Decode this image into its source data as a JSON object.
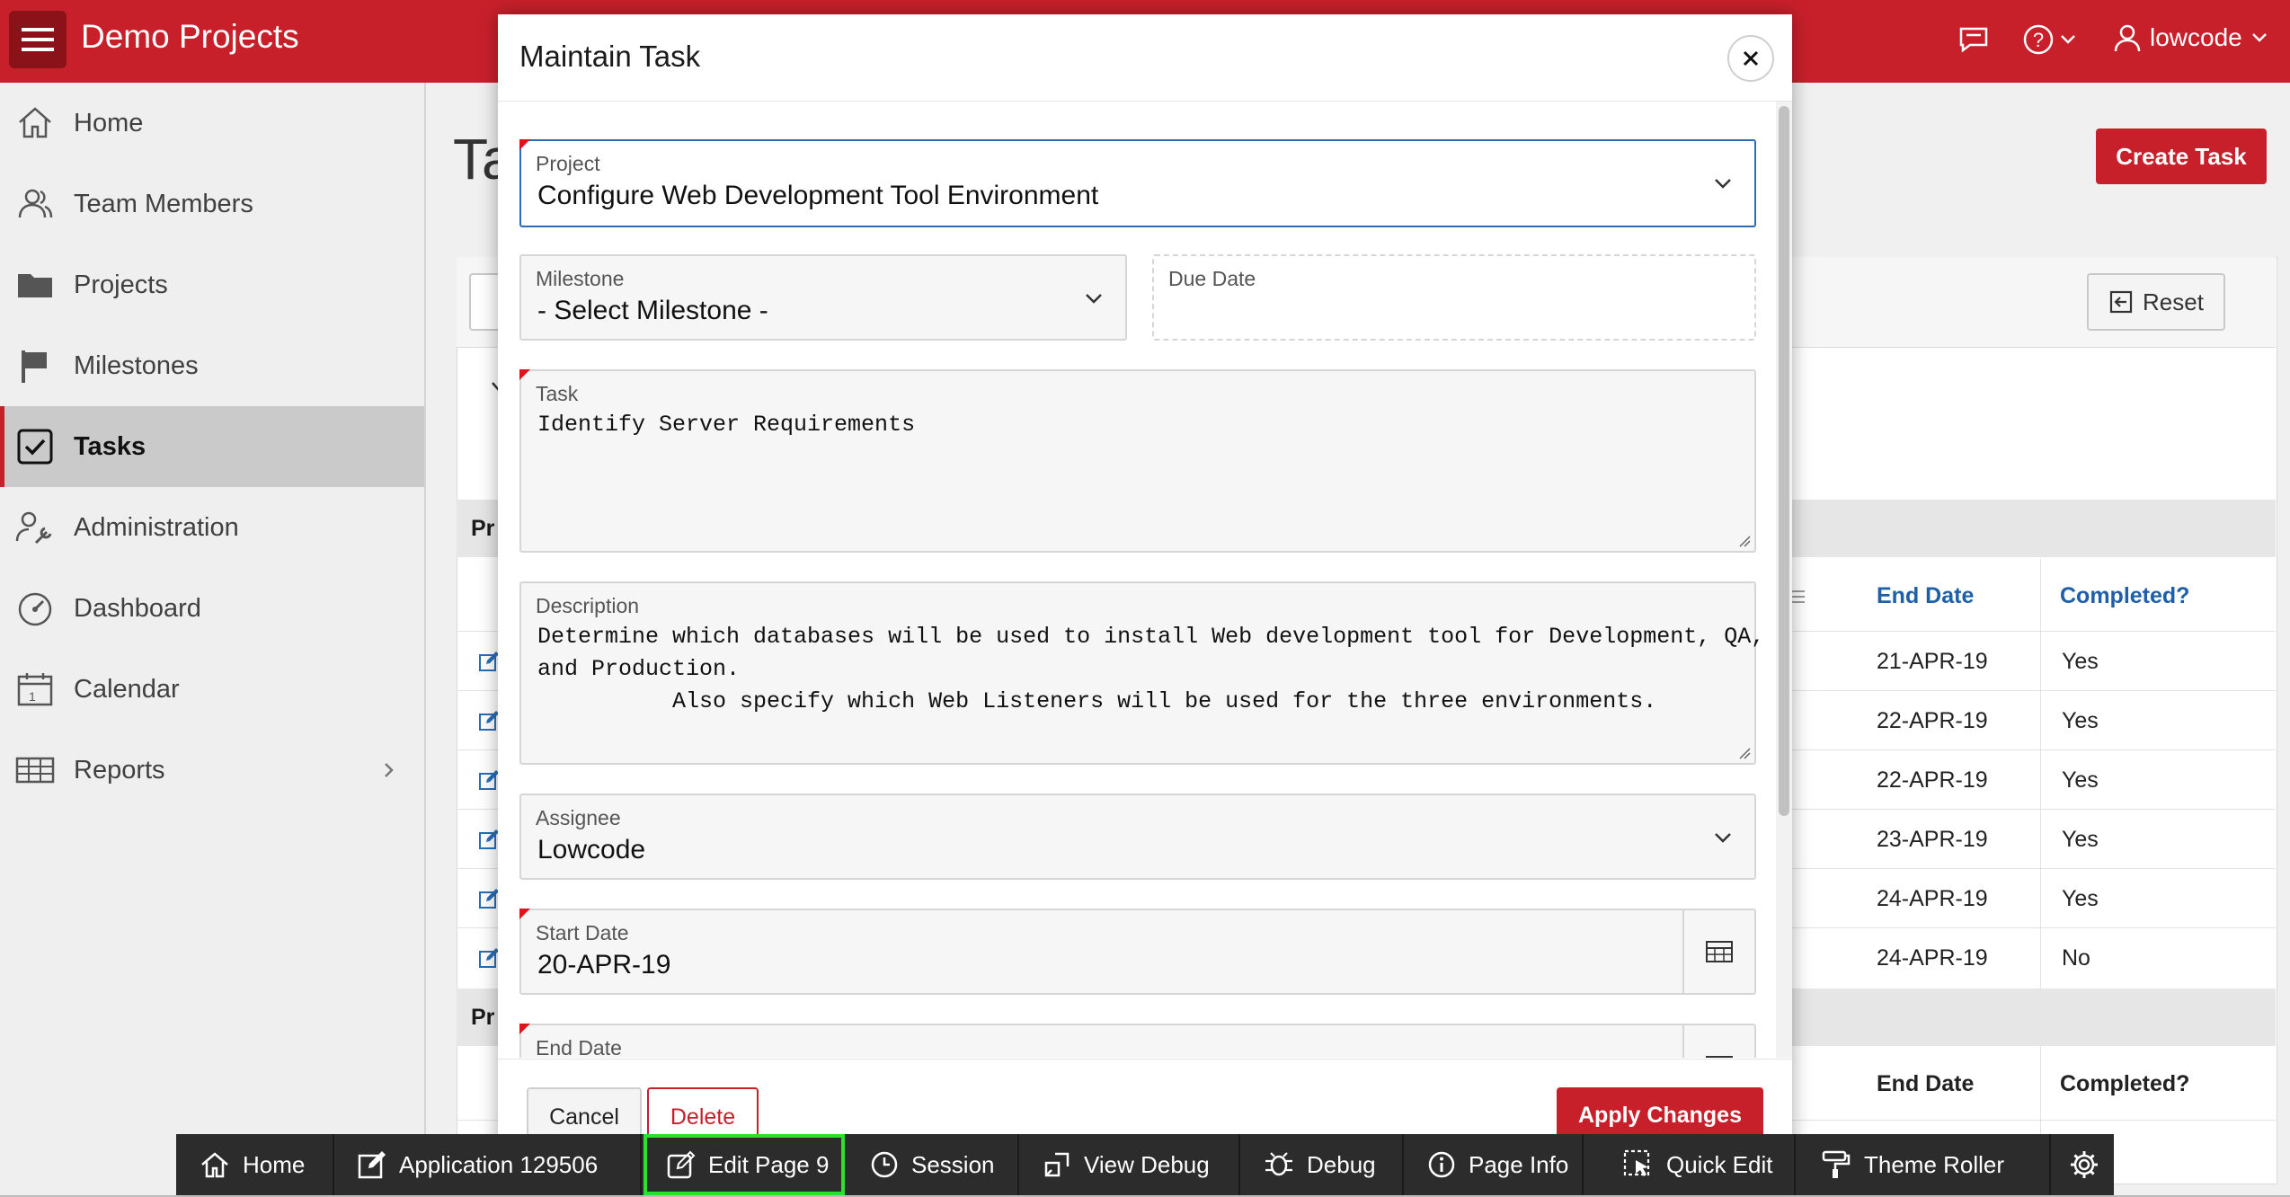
{
  "header": {
    "app_title": "Demo Projects",
    "user": "lowcode",
    "icons": [
      "hamburger-menu-icon",
      "chat-icon",
      "help-icon",
      "user-icon"
    ]
  },
  "sidebar": {
    "items": [
      {
        "label": "Home",
        "icon": "home-icon"
      },
      {
        "label": "Team Members",
        "icon": "people-icon"
      },
      {
        "label": "Projects",
        "icon": "folder-icon"
      },
      {
        "label": "Milestones",
        "icon": "flag-icon"
      },
      {
        "label": "Tasks",
        "icon": "checkbox-icon",
        "active": true
      },
      {
        "label": "Administration",
        "icon": "wrench-user-icon"
      },
      {
        "label": "Dashboard",
        "icon": "gauge-icon"
      },
      {
        "label": "Calendar",
        "icon": "calendar-icon"
      },
      {
        "label": "Reports",
        "icon": "table-icon"
      }
    ]
  },
  "background_page": {
    "title_partial": "Ta",
    "create_button": "Create Task",
    "reset_button": "Reset",
    "group_label_partial": "Pr",
    "group2_label_partial": "Pr",
    "columns": {
      "end_date": "End Date",
      "completed": "Completed?"
    },
    "rows": [
      {
        "end_date": "21-APR-19",
        "completed": "Yes"
      },
      {
        "end_date": "22-APR-19",
        "completed": "Yes"
      },
      {
        "end_date": "22-APR-19",
        "completed": "Yes"
      },
      {
        "end_date": "23-APR-19",
        "completed": "Yes"
      },
      {
        "end_date": "24-APR-19",
        "completed": "Yes"
      },
      {
        "end_date": "24-APR-19",
        "completed": "No"
      }
    ],
    "columns2": {
      "end_date": "End Date",
      "completed": "Completed?"
    }
  },
  "modal": {
    "title": "Maintain Task",
    "fields": {
      "project": {
        "label": "Project",
        "value": "Configure Web Development Tool Environment"
      },
      "milestone": {
        "label": "Milestone",
        "value": "- Select Milestone -"
      },
      "due_date": {
        "label": "Due Date",
        "value": ""
      },
      "task": {
        "label": "Task",
        "value": "Identify Server Requirements"
      },
      "description": {
        "label": "Description",
        "value": "Determine which databases will be used to install Web development tool for Development, QA,\nand Production.\n          Also specify which Web Listeners will be used for the three environments."
      },
      "assignee": {
        "label": "Assignee",
        "value": "Lowcode"
      },
      "start_date": {
        "label": "Start Date",
        "value": "20-APR-19"
      },
      "end_date": {
        "label": "End Date",
        "value": ""
      }
    },
    "buttons": {
      "cancel": "Cancel",
      "delete": "Delete",
      "apply": "Apply Changes"
    }
  },
  "dev_toolbar": {
    "items": [
      {
        "label": "Home",
        "icon": "home-icon"
      },
      {
        "label": "Application 129506",
        "icon": "edit-app-icon"
      },
      {
        "label": "Edit Page 9",
        "icon": "edit-page-icon",
        "highlighted": true
      },
      {
        "label": "Session",
        "icon": "clock-icon"
      },
      {
        "label": "View Debug",
        "icon": "view-debug-icon"
      },
      {
        "label": "Debug",
        "icon": "bug-icon"
      },
      {
        "label": "Page Info",
        "icon": "info-icon"
      },
      {
        "label": "Quick Edit",
        "icon": "quick-edit-icon"
      },
      {
        "label": "Theme Roller",
        "icon": "paint-roller-icon"
      },
      {
        "label": "",
        "icon": "gear-icon"
      }
    ]
  },
  "colors": {
    "brand": "#c8202b",
    "highlight": "#2ee02e",
    "dev_toolbar_bg": "#2c2c2c"
  }
}
